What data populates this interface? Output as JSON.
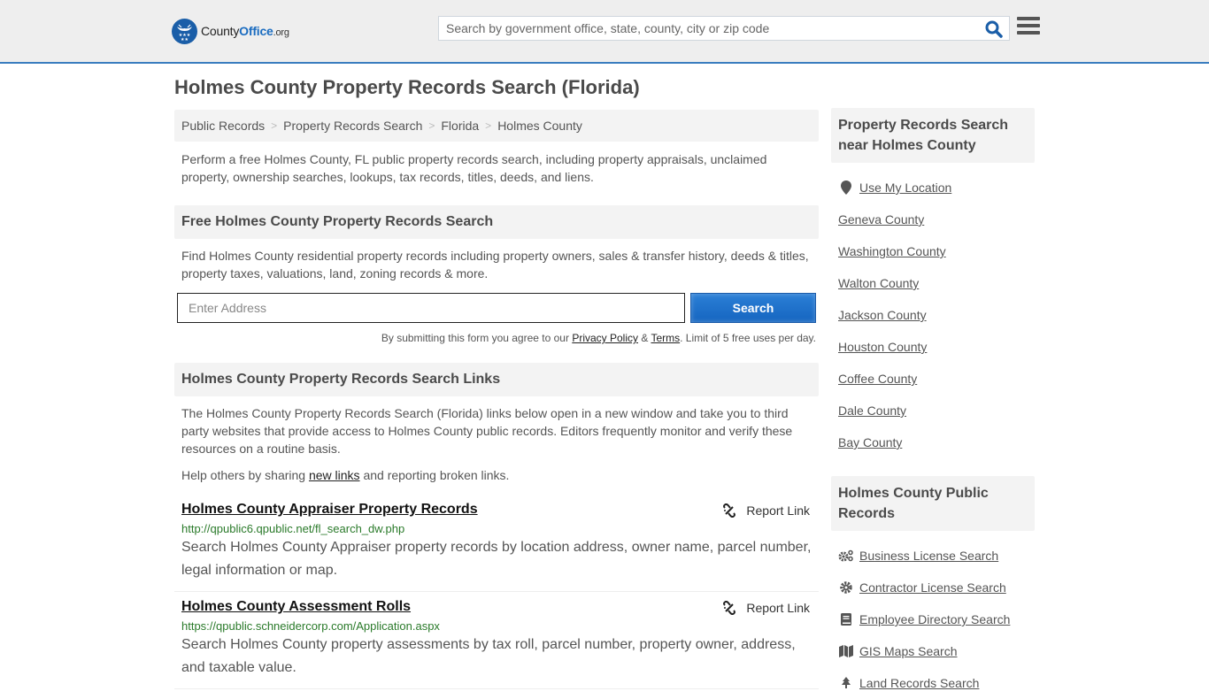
{
  "header": {
    "logo": {
      "county": "County",
      "office": "Office",
      "org": ".org"
    },
    "search_placeholder": "Search by government office, state, county, city or zip code",
    "colors": {
      "accent": "#3a7dbf",
      "brand": "#1a5ea8"
    }
  },
  "page": {
    "title": "Holmes County Property Records Search (Florida)"
  },
  "breadcrumb": [
    {
      "label": "Public Records"
    },
    {
      "label": "Property Records Search"
    },
    {
      "label": "Florida"
    },
    {
      "label": "Holmes County"
    }
  ],
  "intro": "Perform a free Holmes County, FL public property records search, including property appraisals, unclaimed property, ownership searches, lookups, tax records, titles, deeds, and liens.",
  "free_search": {
    "heading": "Free Holmes County Property Records Search",
    "description": "Find Holmes County residential property records including property owners, sales & transfer history, deeds & titles, property taxes, valuations, land, zoning records & more.",
    "address_placeholder": "Enter Address",
    "button_label": "Search",
    "disclaimer": {
      "prefix": "By submitting this form you agree to our ",
      "privacy": "Privacy Policy",
      "amp": " & ",
      "terms": "Terms",
      "suffix": ". Limit of 5 free uses per day."
    }
  },
  "links_section": {
    "heading": "Holmes County Property Records Search Links",
    "description": "The Holmes County Property Records Search (Florida) links below open in a new window and take you to third party websites that provide access to Holmes County public records. Editors frequently monitor and verify these resources on a routine basis.",
    "help": {
      "prefix": "Help others by sharing ",
      "link": "new links",
      "suffix": " and reporting broken links."
    },
    "report_label": "Report Link",
    "items": [
      {
        "title": "Holmes County Appraiser Property Records",
        "url": "http://qpublic6.qpublic.net/fl_search_dw.php",
        "description": "Search Holmes County Appraiser property records by location address, owner name, parcel number, legal information or map."
      },
      {
        "title": "Holmes County Assessment Rolls",
        "url": "https://qpublic.schneidercorp.com/Application.aspx",
        "description": "Search Holmes County property assessments by tax roll, parcel number, property owner, address, and taxable value."
      }
    ]
  },
  "sidebar": {
    "nearby": {
      "heading": "Property Records Search near Holmes County",
      "use_location": "Use My Location",
      "counties": [
        "Geneva County",
        "Washington County",
        "Walton County",
        "Jackson County",
        "Houston County",
        "Coffee County",
        "Dale County",
        "Bay County"
      ]
    },
    "public_records": {
      "heading": "Holmes County Public Records",
      "items": [
        {
          "label": "Business License Search",
          "icon": "cogs-icon"
        },
        {
          "label": "Contractor License Search",
          "icon": "gear-icon"
        },
        {
          "label": "Employee Directory Search",
          "icon": "book-icon"
        },
        {
          "label": "GIS Maps Search",
          "icon": "map-icon"
        },
        {
          "label": "Land Records Search",
          "icon": "tree-icon"
        }
      ]
    }
  }
}
